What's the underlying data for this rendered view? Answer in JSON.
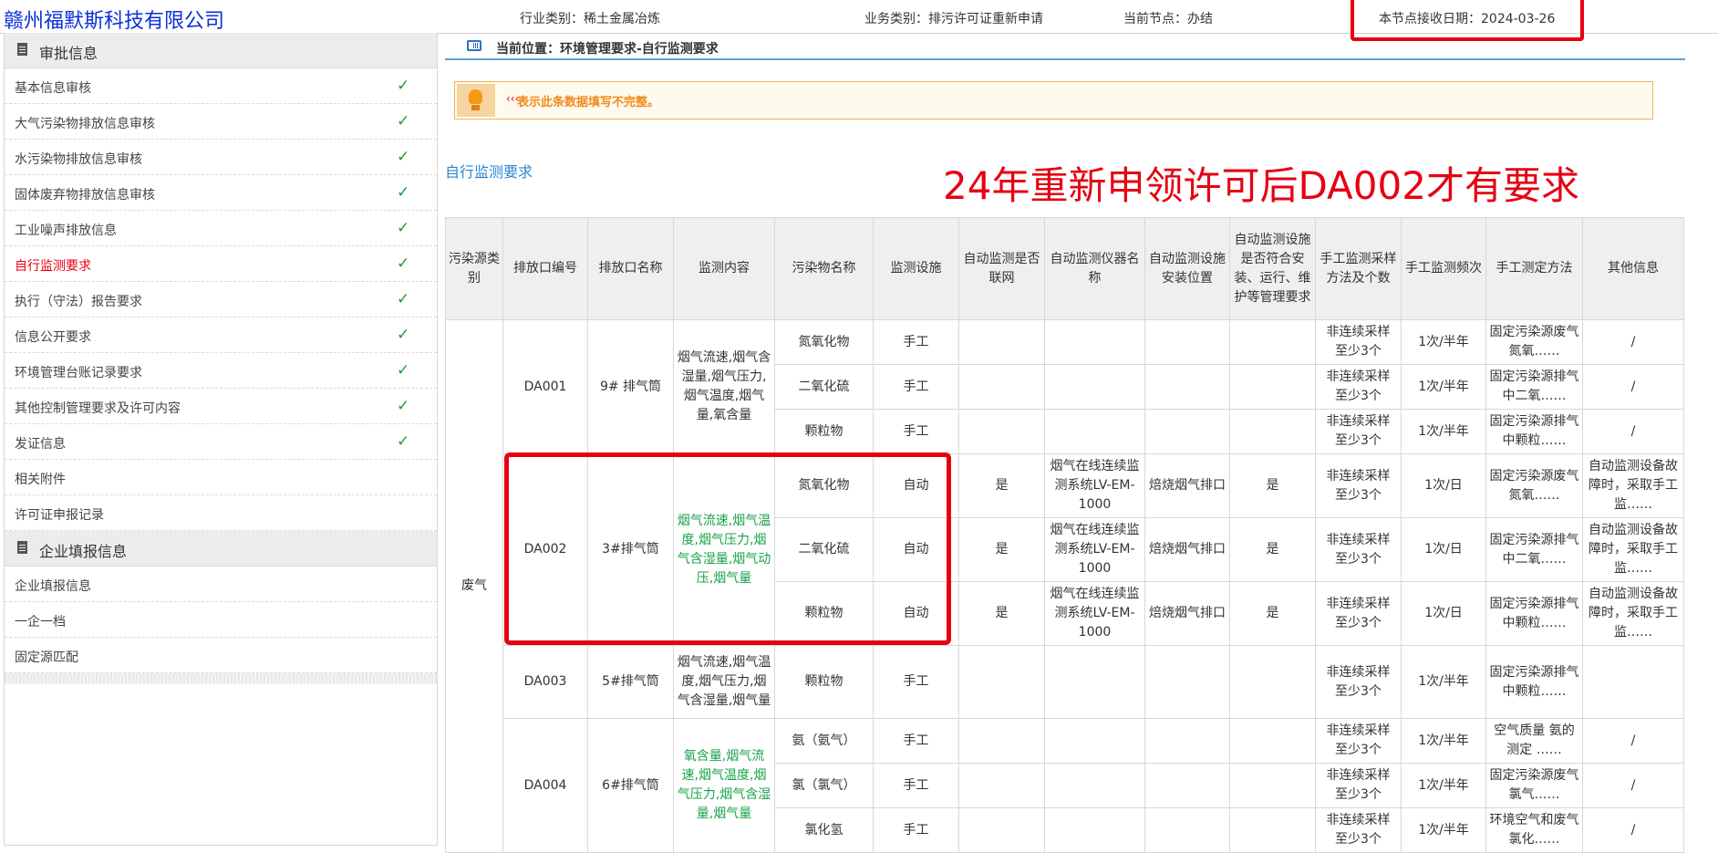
{
  "header": {
    "company": "赣州福默斯科技有限公司",
    "industry": "行业类别：稀土金属冶炼",
    "business": "业务类别：排污许可证重新申请",
    "node": "当前节点：办结",
    "receive_date": "本节点接收日期：2024-03-26"
  },
  "sidebar": {
    "section1": "审批信息",
    "items1": [
      {
        "label": "基本信息审核"
      },
      {
        "label": "大气污染物排放信息审核"
      },
      {
        "label": "水污染物排放信息审核"
      },
      {
        "label": "固体废弃物排放信息审核"
      },
      {
        "label": "工业噪声排放信息"
      },
      {
        "label": "自行监测要求"
      },
      {
        "label": "执行（守法）报告要求"
      },
      {
        "label": "信息公开要求"
      },
      {
        "label": "环境管理台账记录要求"
      },
      {
        "label": "其他控制管理要求及许可内容"
      },
      {
        "label": "发证信息"
      },
      {
        "label": "相关附件"
      },
      {
        "label": "许可证申报记录"
      }
    ],
    "section2": "企业填报信息",
    "items2": [
      {
        "label": "企业填报信息"
      },
      {
        "label": "一企一档"
      },
      {
        "label": "固定源匹配"
      }
    ]
  },
  "breadcrumb": "当前位置：环境管理要求-自行监测要求",
  "notice": {
    "arrow": "‹‹‹",
    "text": "表示此条数据填写不完整。"
  },
  "section_title": "自行监测要求",
  "annotation": "24年重新申领许可后DA002才有要求",
  "table": {
    "headers": [
      "污染源类别",
      "排放口编号",
      "排放口名称",
      "监测内容",
      "污染物名称",
      "监测设施",
      "自动监测是否联网",
      "自动监测仪器名称",
      "自动监测设施安装位置",
      "自动监测设施是否符合安装、运行、维护等管理要求",
      "手工监测采样方法及个数",
      "手工监测频次",
      "手工测定方法",
      "其他信息"
    ],
    "category": "废气",
    "outlets": [
      {
        "code": "DA001",
        "name": "9# 排气筒",
        "content": "烟气流速,烟气含湿量,烟气压力,烟气温度,烟气量,氧含量",
        "rows": [
          {
            "pollutant": "氮氧化物",
            "facility": "手工",
            "networked": "",
            "instrument": "",
            "location": "",
            "compliant": "",
            "method": "非连续采样 至少3个",
            "freq": "1次/半年",
            "measure": "固定污染源废气 氮氧……",
            "other": "/"
          },
          {
            "pollutant": "二氧化硫",
            "facility": "手工",
            "networked": "",
            "instrument": "",
            "location": "",
            "compliant": "",
            "method": "非连续采样 至少3个",
            "freq": "1次/半年",
            "measure": "固定污染源排气中二氧……",
            "other": "/"
          },
          {
            "pollutant": "颗粒物",
            "facility": "手工",
            "networked": "",
            "instrument": "",
            "location": "",
            "compliant": "",
            "method": "非连续采样 至少3个",
            "freq": "1次/半年",
            "measure": "固定污染源排气中颗粒……",
            "other": "/"
          }
        ]
      },
      {
        "code": "DA002",
        "name": "3#排气筒",
        "content": "烟气流速,烟气温度,烟气压力,烟气含湿量,烟气动压,烟气量",
        "rows": [
          {
            "pollutant": "氮氧化物",
            "facility": "自动",
            "networked": "是",
            "instrument": "烟气在线连续监测系统LV-EM-1000",
            "location": "焙烧烟气排口",
            "compliant": "是",
            "method": "非连续采样 至少3个",
            "freq": "1次/日",
            "measure": "固定污染源废气 氮氧……",
            "other": "自动监测设备故障时，采取手工监……"
          },
          {
            "pollutant": "二氧化硫",
            "facility": "自动",
            "networked": "是",
            "instrument": "烟气在线连续监测系统LV-EM-1000",
            "location": "焙烧烟气排口",
            "compliant": "是",
            "method": "非连续采样 至少3个",
            "freq": "1次/日",
            "measure": "固定污染源排气中二氧……",
            "other": "自动监测设备故障时，采取手工监……"
          },
          {
            "pollutant": "颗粒物",
            "facility": "自动",
            "networked": "是",
            "instrument": "烟气在线连续监测系统LV-EM-1000",
            "location": "焙烧烟气排口",
            "compliant": "是",
            "method": "非连续采样 至少3个",
            "freq": "1次/日",
            "measure": "固定污染源排气中颗粒……",
            "other": "自动监测设备故障时，采取手工监……"
          }
        ]
      },
      {
        "code": "DA003",
        "name": "5#排气筒",
        "content": "烟气流速,烟气温度,烟气压力,烟气含湿量,烟气量",
        "rows": [
          {
            "pollutant": "颗粒物",
            "facility": "手工",
            "networked": "",
            "instrument": "",
            "location": "",
            "compliant": "",
            "method": "非连续采样 至少3个",
            "freq": "1次/半年",
            "measure": "固定污染源排气中颗粒……",
            "other": ""
          }
        ]
      },
      {
        "code": "DA004",
        "name": "6#排气筒",
        "content": "氧含量,烟气流速,烟气温度,烟气压力,烟气含湿量,烟气量",
        "rows": [
          {
            "pollutant": "氨（氨气）",
            "facility": "手工",
            "networked": "",
            "instrument": "",
            "location": "",
            "compliant": "",
            "method": "非连续采样 至少3个",
            "freq": "1次/半年",
            "measure": "空气质量 氨的测定 ……",
            "other": "/"
          },
          {
            "pollutant": "氯（氯气）",
            "facility": "手工",
            "networked": "",
            "instrument": "",
            "location": "",
            "compliant": "",
            "method": "非连续采样 至少3个",
            "freq": "1次/半年",
            "measure": "固定污染源废气 氯气……",
            "other": "/"
          },
          {
            "pollutant": "氯化氢",
            "facility": "手工",
            "networked": "",
            "instrument": "",
            "location": "",
            "compliant": "",
            "method": "非连续采样 至少3个",
            "freq": "1次/半年",
            "measure": "环境空气和废气 氯化……",
            "other": "/"
          }
        ]
      }
    ]
  },
  "colors": {
    "accent_red": "#e60012",
    "link_blue": "#2a86d3",
    "check_green": "#1a9d3a",
    "content_green": "#1aa14a"
  }
}
